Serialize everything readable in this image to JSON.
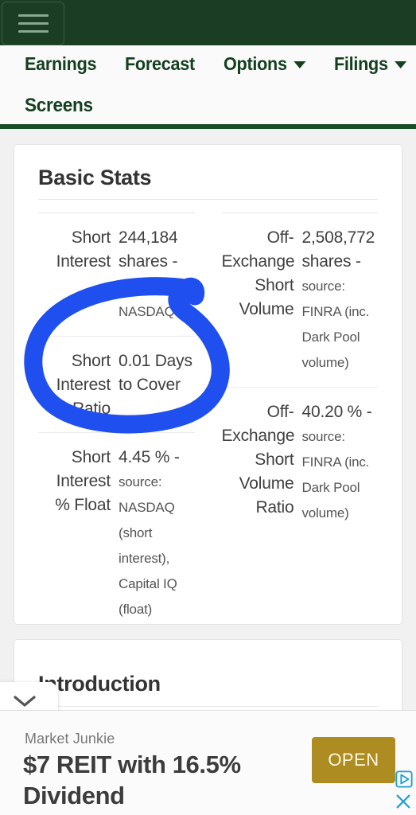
{
  "topbar": {
    "menu_icon": "hamburger-icon"
  },
  "nav": {
    "items": [
      {
        "label": "Earnings",
        "has_caret": false
      },
      {
        "label": "Forecast",
        "has_caret": false
      },
      {
        "label": "Options",
        "has_caret": true
      },
      {
        "label": "Filings",
        "has_caret": true
      }
    ],
    "tab": {
      "label": "Screens",
      "active": true
    }
  },
  "basic_stats": {
    "title": "Basic Stats",
    "left_column": [
      {
        "label": "Short Interest",
        "value": "244,184 shares - ",
        "source": "source: NASDAQ"
      },
      {
        "label": "Short Interest Ratio",
        "value": "0.01 Days to Cover",
        "source": ""
      },
      {
        "label": "Short Interest % Float",
        "value": "4.45 % - ",
        "source": "source: NASDAQ (short interest), Capital IQ (float)"
      }
    ],
    "right_column": [
      {
        "label": "Off-Exchange Short Volume",
        "value": "2,508,772 shares - ",
        "source": "source: FINRA (inc. Dark Pool volume)"
      },
      {
        "label": "Off-Exchange Short Volume Ratio",
        "value": "40.20 % - ",
        "source": "source: FINRA (inc. Dark Pool volume)"
      }
    ]
  },
  "introduction": {
    "title": "Introduction"
  },
  "collapse": {
    "icon": "chevron-down-icon"
  },
  "annotation": {
    "shape": "hand-drawn-circle",
    "color": "#1f4fee",
    "targets": "Short Interest Ratio 0.01 Days to Cover"
  },
  "ad": {
    "advertiser": "Market Junkie",
    "headline": "$7 REIT with 16.5% Dividend",
    "cta_label": "OPEN",
    "cta_color": "#ad8d21",
    "adchoices_icon": "adchoices-icon",
    "close_icon": "close-icon"
  },
  "colors": {
    "header_green": "#1b3d23",
    "accent_green": "#1b4d2a",
    "nav_text": "#14401f",
    "page_bg": "#f1f1f1",
    "annotation_blue": "#1f4fee"
  }
}
